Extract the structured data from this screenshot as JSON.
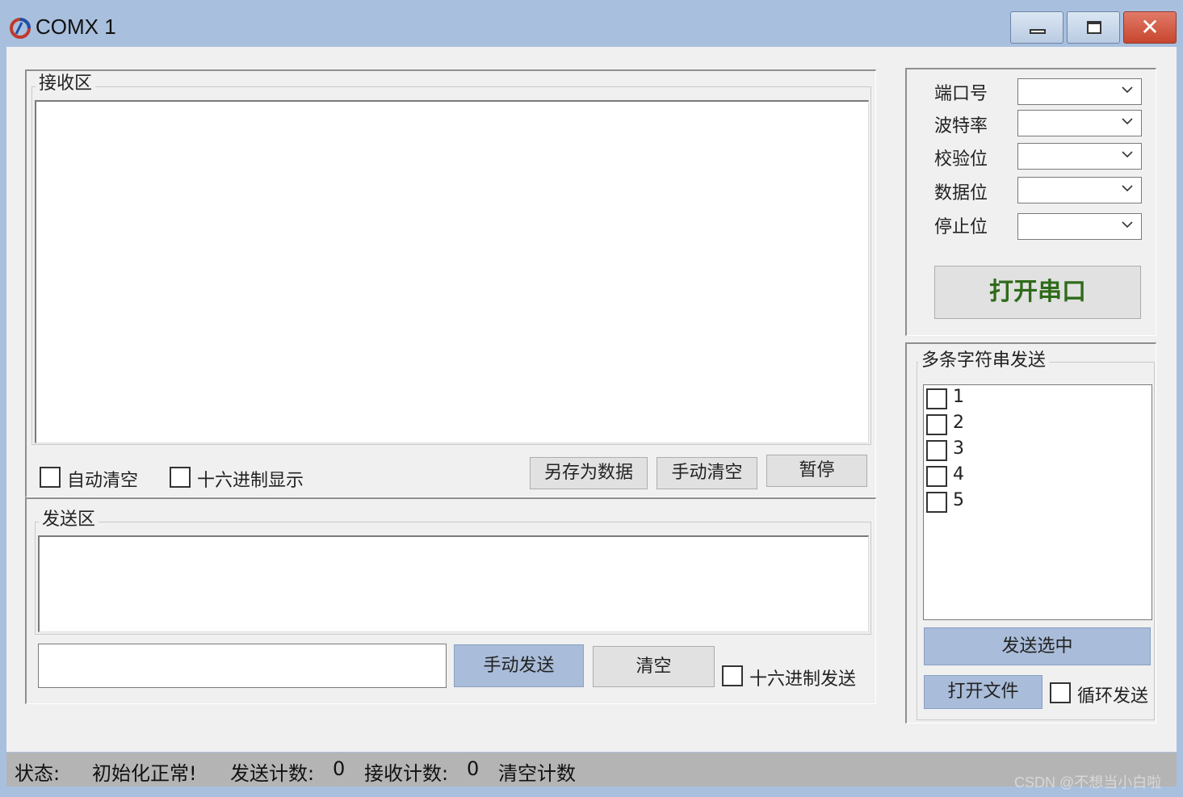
{
  "window": {
    "title": "COMX 1",
    "close_glyph": "✕"
  },
  "receive": {
    "legend": "接收区",
    "auto_clear_label": "自动清空",
    "hex_display_label": "十六进制显示",
    "save_button": "另存为数据",
    "manual_clear_button": "手动清空",
    "pause_button": "暂停"
  },
  "send": {
    "legend": "发送区",
    "manual_send_button": "手动发送",
    "clear_button": "清空",
    "hex_send_label": "十六进制发送"
  },
  "serial": {
    "port_label": "端口号",
    "baud_label": "波特率",
    "parity_label": "校验位",
    "databits_label": "数据位",
    "stopbits_label": "停止位",
    "open_button": "打开串口",
    "open_button_color": "#2f6b1a"
  },
  "multi": {
    "legend": "多条字符串发送",
    "items": [
      "1",
      "2",
      "3",
      "4",
      "5"
    ],
    "send_selected_button": "发送选中",
    "open_file_button": "打开文件",
    "loop_send_label": "循环发送"
  },
  "status": {
    "state_label": "状态:",
    "state_value": "初始化正常!",
    "send_count_label": "发送计数:",
    "send_count_value": "0",
    "recv_count_label": "接收计数:",
    "recv_count_value": "0",
    "clear_count_label": "清空计数"
  },
  "watermark": "CSDN @不想当小白啦"
}
